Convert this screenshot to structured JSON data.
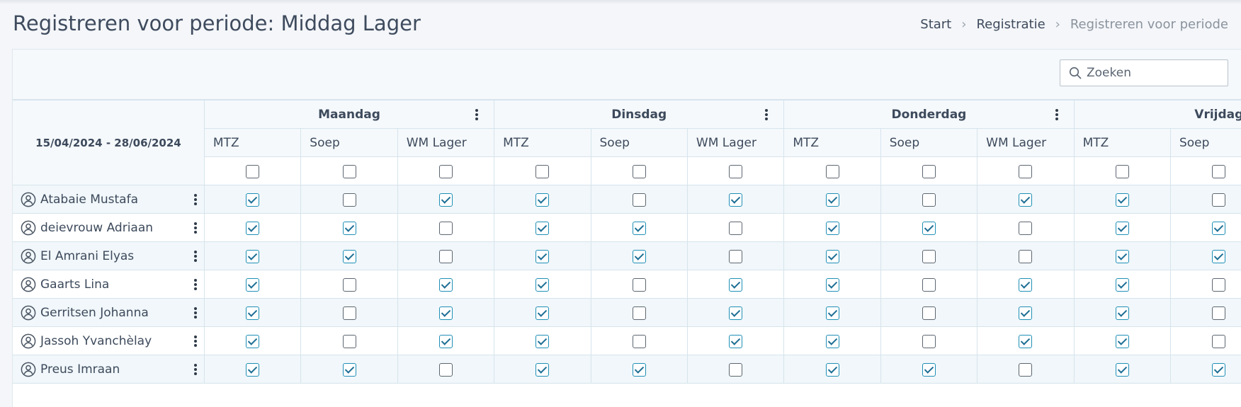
{
  "page": {
    "title": "Registreren voor periode: Middag Lager"
  },
  "breadcrumb": [
    {
      "label": "Start",
      "current": false
    },
    {
      "label": "Registratie",
      "current": false
    },
    {
      "label": "Registreren voor periode",
      "current": true
    }
  ],
  "search": {
    "placeholder": "Zoeken",
    "value": ""
  },
  "table": {
    "period": "15/04/2024 - 28/06/2024",
    "days": [
      {
        "label": "Maandag"
      },
      {
        "label": "Dinsdag"
      },
      {
        "label": "Donderdag"
      },
      {
        "label": "Vrijdag"
      }
    ],
    "columns": [
      "MTZ",
      "Soep",
      "WM Lager"
    ],
    "rows": [
      {
        "name": "Atabaie Mustafa",
        "checks": [
          1,
          0,
          1,
          1,
          0,
          1,
          1,
          0,
          1,
          1,
          0,
          1
        ]
      },
      {
        "name": "deievrouw Adriaan",
        "checks": [
          1,
          1,
          0,
          1,
          1,
          0,
          1,
          1,
          0,
          1,
          1,
          0
        ]
      },
      {
        "name": "El Amrani Elyas",
        "checks": [
          1,
          1,
          0,
          1,
          1,
          0,
          1,
          0,
          0,
          1,
          1,
          0
        ]
      },
      {
        "name": "Gaarts Lina",
        "checks": [
          1,
          0,
          1,
          1,
          0,
          1,
          1,
          0,
          1,
          1,
          0,
          1
        ]
      },
      {
        "name": "Gerritsen Johanna",
        "checks": [
          1,
          0,
          1,
          1,
          0,
          1,
          1,
          0,
          1,
          1,
          0,
          1
        ]
      },
      {
        "name": "Jassoh Yvanchèlay",
        "checks": [
          1,
          0,
          1,
          1,
          0,
          1,
          1,
          0,
          1,
          1,
          0,
          1
        ]
      },
      {
        "name": "Preus Imraan",
        "checks": [
          1,
          1,
          0,
          1,
          1,
          0,
          1,
          1,
          0,
          1,
          1,
          0
        ]
      }
    ]
  },
  "colors": {
    "accent": "#1f8fb6",
    "header_bg": "#f5f9fc",
    "stripe_bg": "#f1f7fa"
  },
  "icons": {
    "search": "search-icon",
    "user": "user-circle-icon",
    "menu": "kebab-menu-icon"
  }
}
